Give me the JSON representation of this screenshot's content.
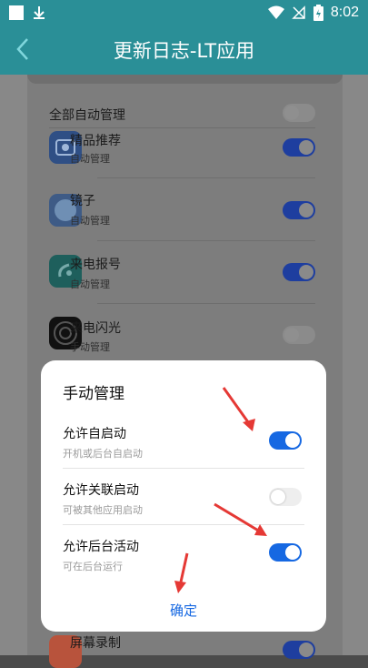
{
  "status_bar": {
    "time": "8:02",
    "icons": [
      "notification-icon",
      "download-icon",
      "wifi-icon",
      "no-sim-icon",
      "battery-icon"
    ]
  },
  "app_bar": {
    "title": "更新日志-LT应用"
  },
  "list": {
    "master": {
      "label": "全部自动管理",
      "enabled": false
    },
    "items": [
      {
        "title": "精品推荐",
        "subtitle": "自动管理",
        "enabled": true,
        "icon": "app-store-icon"
      },
      {
        "title": "镜子",
        "subtitle": "自动管理",
        "enabled": true,
        "icon": "mirror-icon"
      },
      {
        "title": "来电报号",
        "subtitle": "自动管理",
        "enabled": true,
        "icon": "caller-announce-icon"
      },
      {
        "title": "来电闪光",
        "subtitle": "手动管理",
        "enabled": false,
        "icon": "flash-icon"
      },
      {
        "title": "屏幕录制",
        "subtitle": "",
        "enabled": true,
        "icon": "screen-record-icon"
      }
    ]
  },
  "dialog": {
    "title": "手动管理",
    "items": [
      {
        "title": "允许自启动",
        "subtitle": "开机或后台自启动",
        "enabled": true
      },
      {
        "title": "允许关联启动",
        "subtitle": "可被其他应用启动",
        "enabled": false
      },
      {
        "title": "允许后台活动",
        "subtitle": "可在后台运行",
        "enabled": true
      }
    ],
    "confirm_label": "确定"
  },
  "colors": {
    "accent": "#2a8f97",
    "toggle_on": "#1668e2",
    "arrow": "#e53935"
  }
}
